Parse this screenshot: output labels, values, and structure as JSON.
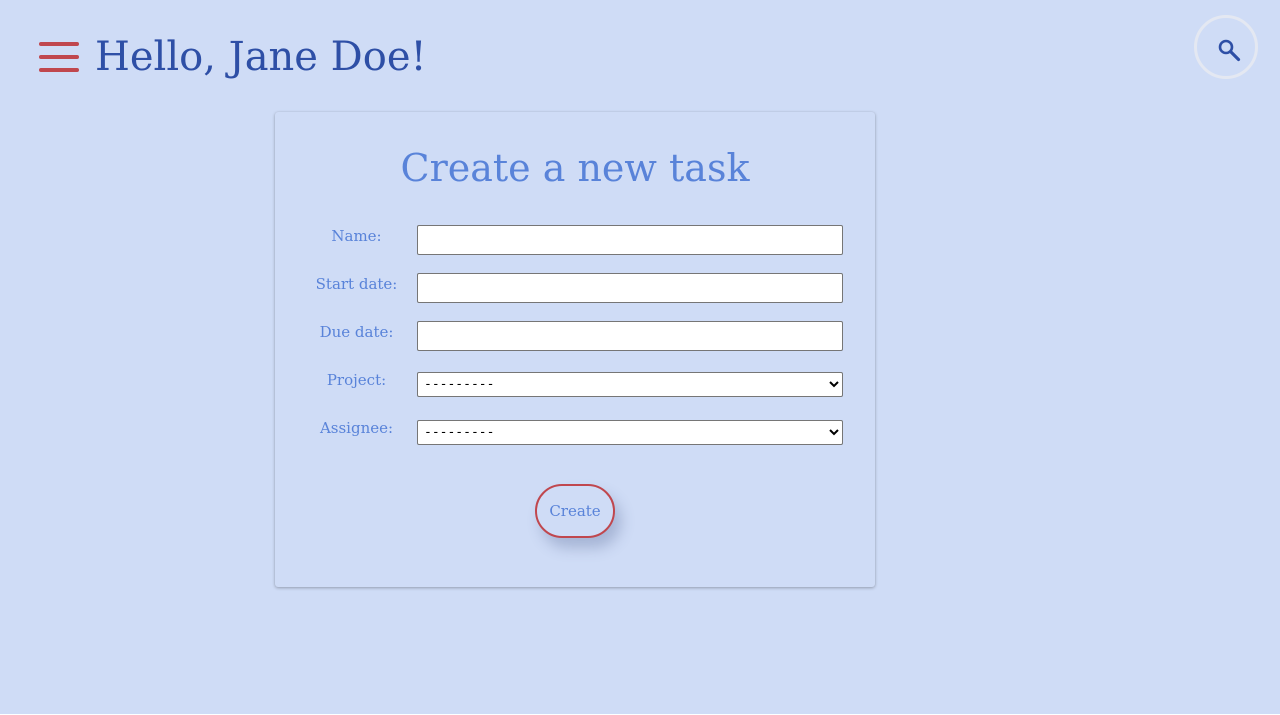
{
  "header": {
    "greeting": "Hello, Jane Doe!",
    "menu_icon": "hamburger-menu-icon",
    "search_icon": "magnifier-icon"
  },
  "form": {
    "title": "Create a new task",
    "fields": {
      "name": {
        "label": "Name:",
        "value": ""
      },
      "start_date": {
        "label": "Start date:",
        "value": ""
      },
      "due_date": {
        "label": "Due date:",
        "value": ""
      },
      "project": {
        "label": "Project:",
        "selected": "---------"
      },
      "assignee": {
        "label": "Assignee:",
        "selected": "---------"
      }
    },
    "submit_label": "Create"
  },
  "colors": {
    "background": "#cfdcf6",
    "greeting": "#2e4fa6",
    "accent_blue": "#5983d9",
    "accent_red": "#c0474e",
    "search_icon": "#2e4fa6"
  }
}
